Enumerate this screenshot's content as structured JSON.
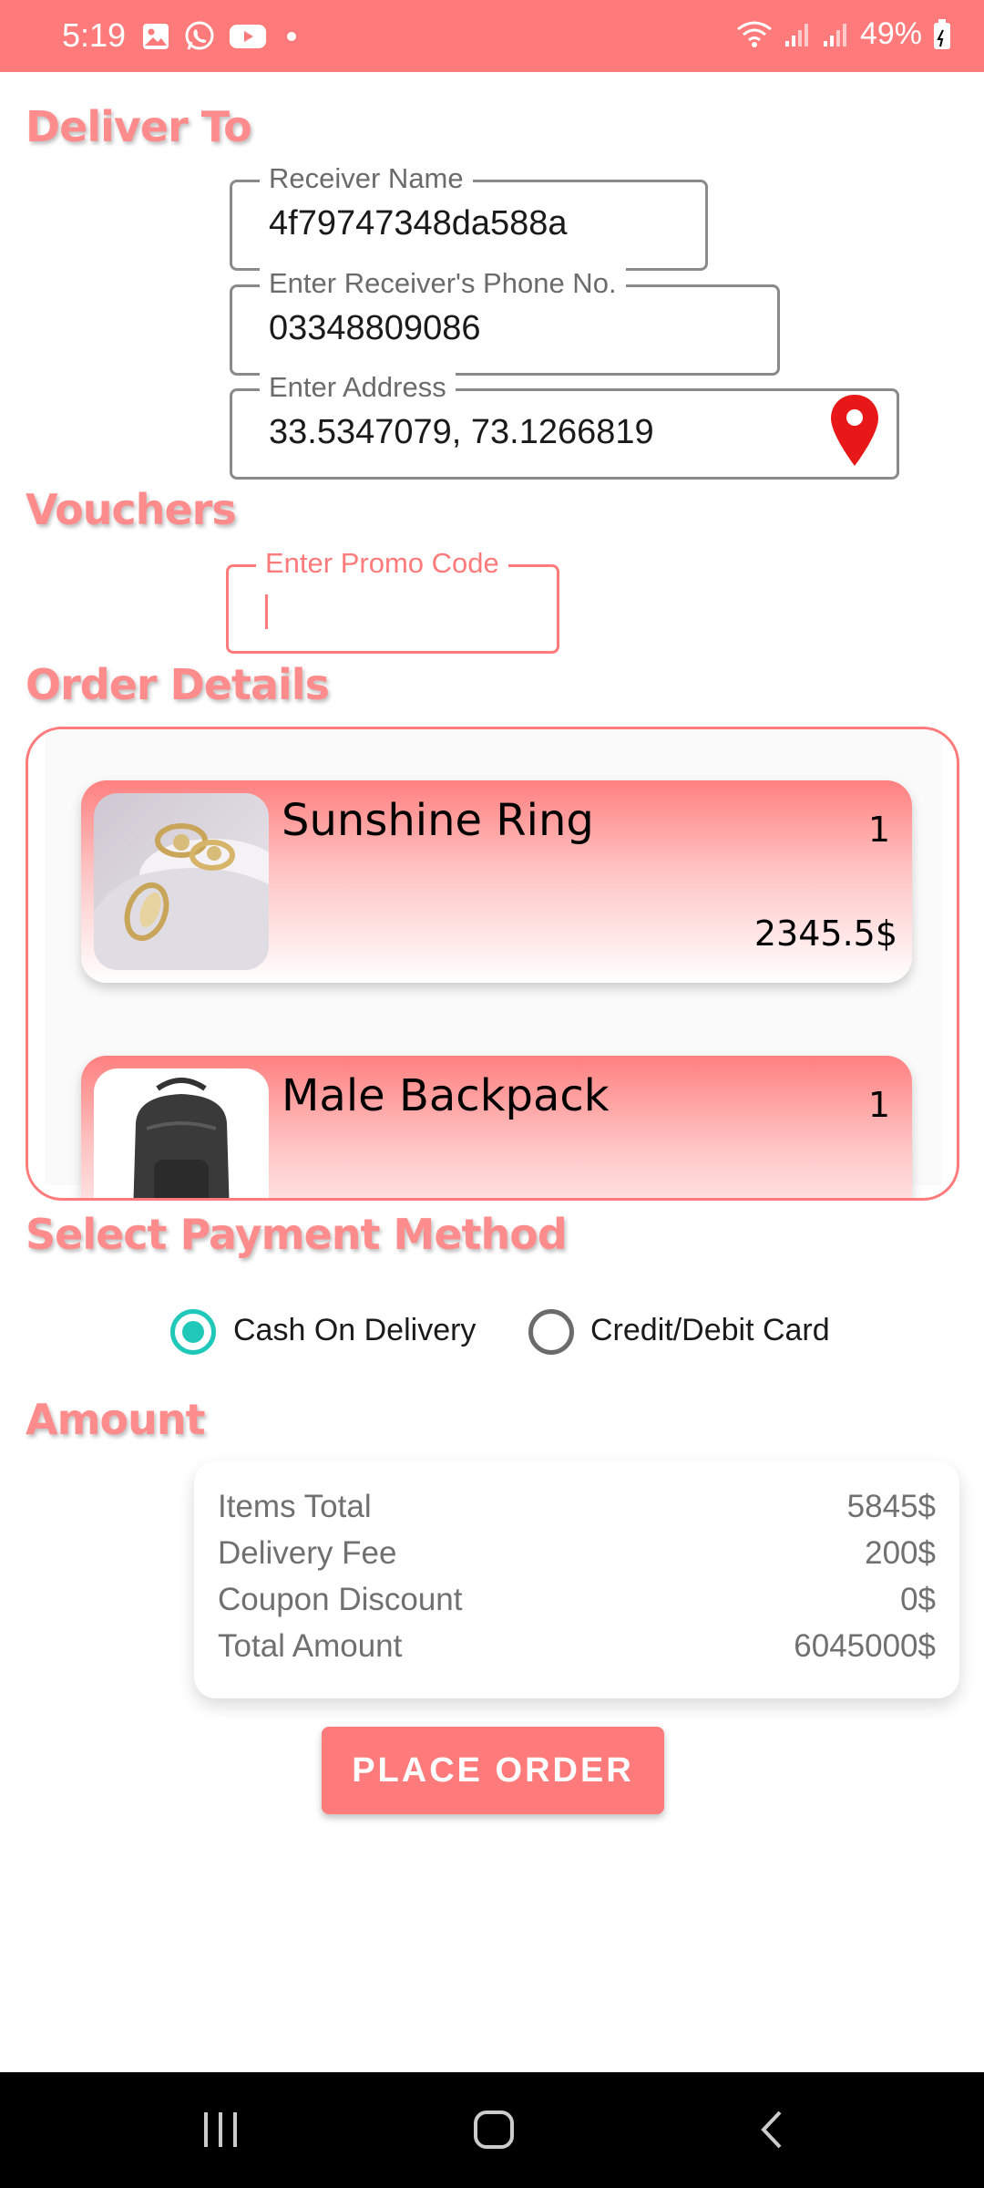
{
  "status_bar": {
    "time": "5:19",
    "battery": "49%",
    "left_icons": [
      "image-icon",
      "whatsapp-icon",
      "youtube-icon",
      "dot-icon"
    ],
    "right_icons": [
      "wifi-icon",
      "signal-icon",
      "signal-icon",
      "battery-icon"
    ]
  },
  "sections": {
    "deliver_to": "Deliver To",
    "vouchers": "Vouchers",
    "order_details": "Order Details",
    "payment_method": "Select Payment Method",
    "amount": "Amount"
  },
  "delivery": {
    "receiver_name_label": "Receiver Name",
    "receiver_name_value": "4f79747348da588a",
    "phone_label": "Enter Receiver's Phone No.",
    "phone_value": "03348809086",
    "address_label": "Enter Address",
    "address_value": "33.5347079, 73.1266819"
  },
  "voucher": {
    "promo_label": "Enter Promo Code",
    "promo_value": ""
  },
  "orders": [
    {
      "name": "Sunshine Ring",
      "qty": "1",
      "price": "2345.5$",
      "image_icon": "rings-photo"
    },
    {
      "name": "Male Backpack",
      "qty": "1",
      "price": "",
      "image_icon": "backpack-photo"
    }
  ],
  "payment": {
    "options": [
      {
        "label": "Cash On Delivery",
        "selected": true
      },
      {
        "label": "Credit/Debit Card",
        "selected": false
      }
    ]
  },
  "amount": {
    "items_total_label": "Items Total",
    "items_total_value": "5845$",
    "delivery_fee_label": "Delivery Fee",
    "delivery_fee_value": "200$",
    "coupon_label": "Coupon Discount",
    "coupon_value": "0$",
    "total_label": "Total Amount",
    "total_value": "6045000$"
  },
  "place_order_label": "PLACE ORDER",
  "colors": {
    "accent": "#FF7B7B",
    "radio_selected": "#1FC8B8",
    "pin": "#E81818"
  }
}
